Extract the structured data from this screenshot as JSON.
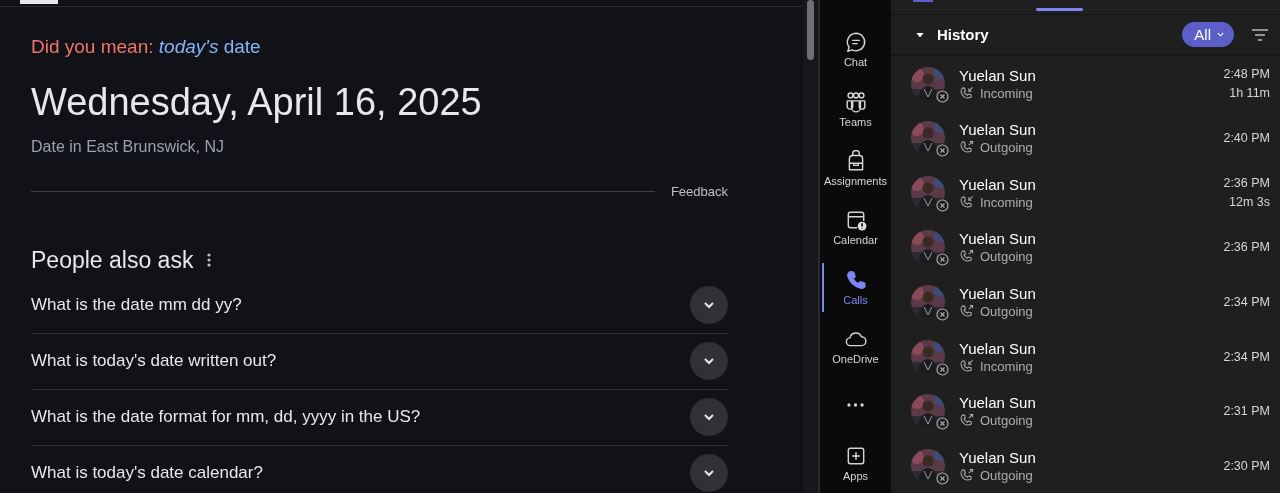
{
  "did_you_mean": {
    "label": "Did you mean:",
    "suggestion": "*today's* date"
  },
  "date_result": {
    "date": "Wednesday, April 16, 2025",
    "location": "Date in East Brunswick, NJ",
    "feedback": "Feedback"
  },
  "people_also_ask": {
    "title": "People also ask",
    "questions": [
      {
        "text": "What is the date mm dd yy?",
        "expanded": false
      },
      {
        "text": "What is today's date written out?",
        "expanded": false
      },
      {
        "text": "What is the date format for mm, dd, yyyy in the US?",
        "expanded": false
      },
      {
        "text": "What is today's date calendar?",
        "expanded": false
      }
    ]
  },
  "app_bar": {
    "items": [
      {
        "kind": "chat",
        "label": "Chat",
        "selected": false
      },
      {
        "kind": "teams",
        "label": "Teams",
        "selected": false
      },
      {
        "kind": "assignments",
        "label": "Assignments",
        "selected": false
      },
      {
        "kind": "calendar",
        "label": "Calendar",
        "selected": false
      },
      {
        "kind": "calls",
        "label": "Calls",
        "selected": true
      },
      {
        "kind": "onedrive",
        "label": "OneDrive",
        "selected": false
      },
      {
        "kind": "more",
        "selected": false
      },
      {
        "kind": "apps",
        "label": "Apps",
        "selected": false
      }
    ]
  },
  "history": {
    "title": "History",
    "expanded": true,
    "filter": "All",
    "calls": [
      {
        "name": "Yuelan Sun",
        "kind": "incoming",
        "direction_label": "Incoming",
        "time": "2:48 PM",
        "duration": "1h 11m"
      },
      {
        "name": "Yuelan Sun",
        "kind": "outgoing",
        "direction_label": "Outgoing",
        "time": "2:40 PM"
      },
      {
        "name": "Yuelan Sun",
        "kind": "incoming",
        "direction_label": "Incoming",
        "time": "2:36 PM",
        "duration": "12m 3s"
      },
      {
        "name": "Yuelan Sun",
        "kind": "outgoing",
        "direction_label": "Outgoing",
        "time": "2:36 PM"
      },
      {
        "name": "Yuelan Sun",
        "kind": "outgoing",
        "direction_label": "Outgoing",
        "time": "2:34 PM"
      },
      {
        "name": "Yuelan Sun",
        "kind": "incoming",
        "direction_label": "Incoming",
        "time": "2:34 PM"
      },
      {
        "name": "Yuelan Sun",
        "kind": "outgoing",
        "direction_label": "Outgoing",
        "time": "2:31 PM"
      },
      {
        "name": "Yuelan Sun",
        "kind": "outgoing",
        "direction_label": "Outgoing",
        "time": "2:30 PM"
      }
    ]
  }
}
